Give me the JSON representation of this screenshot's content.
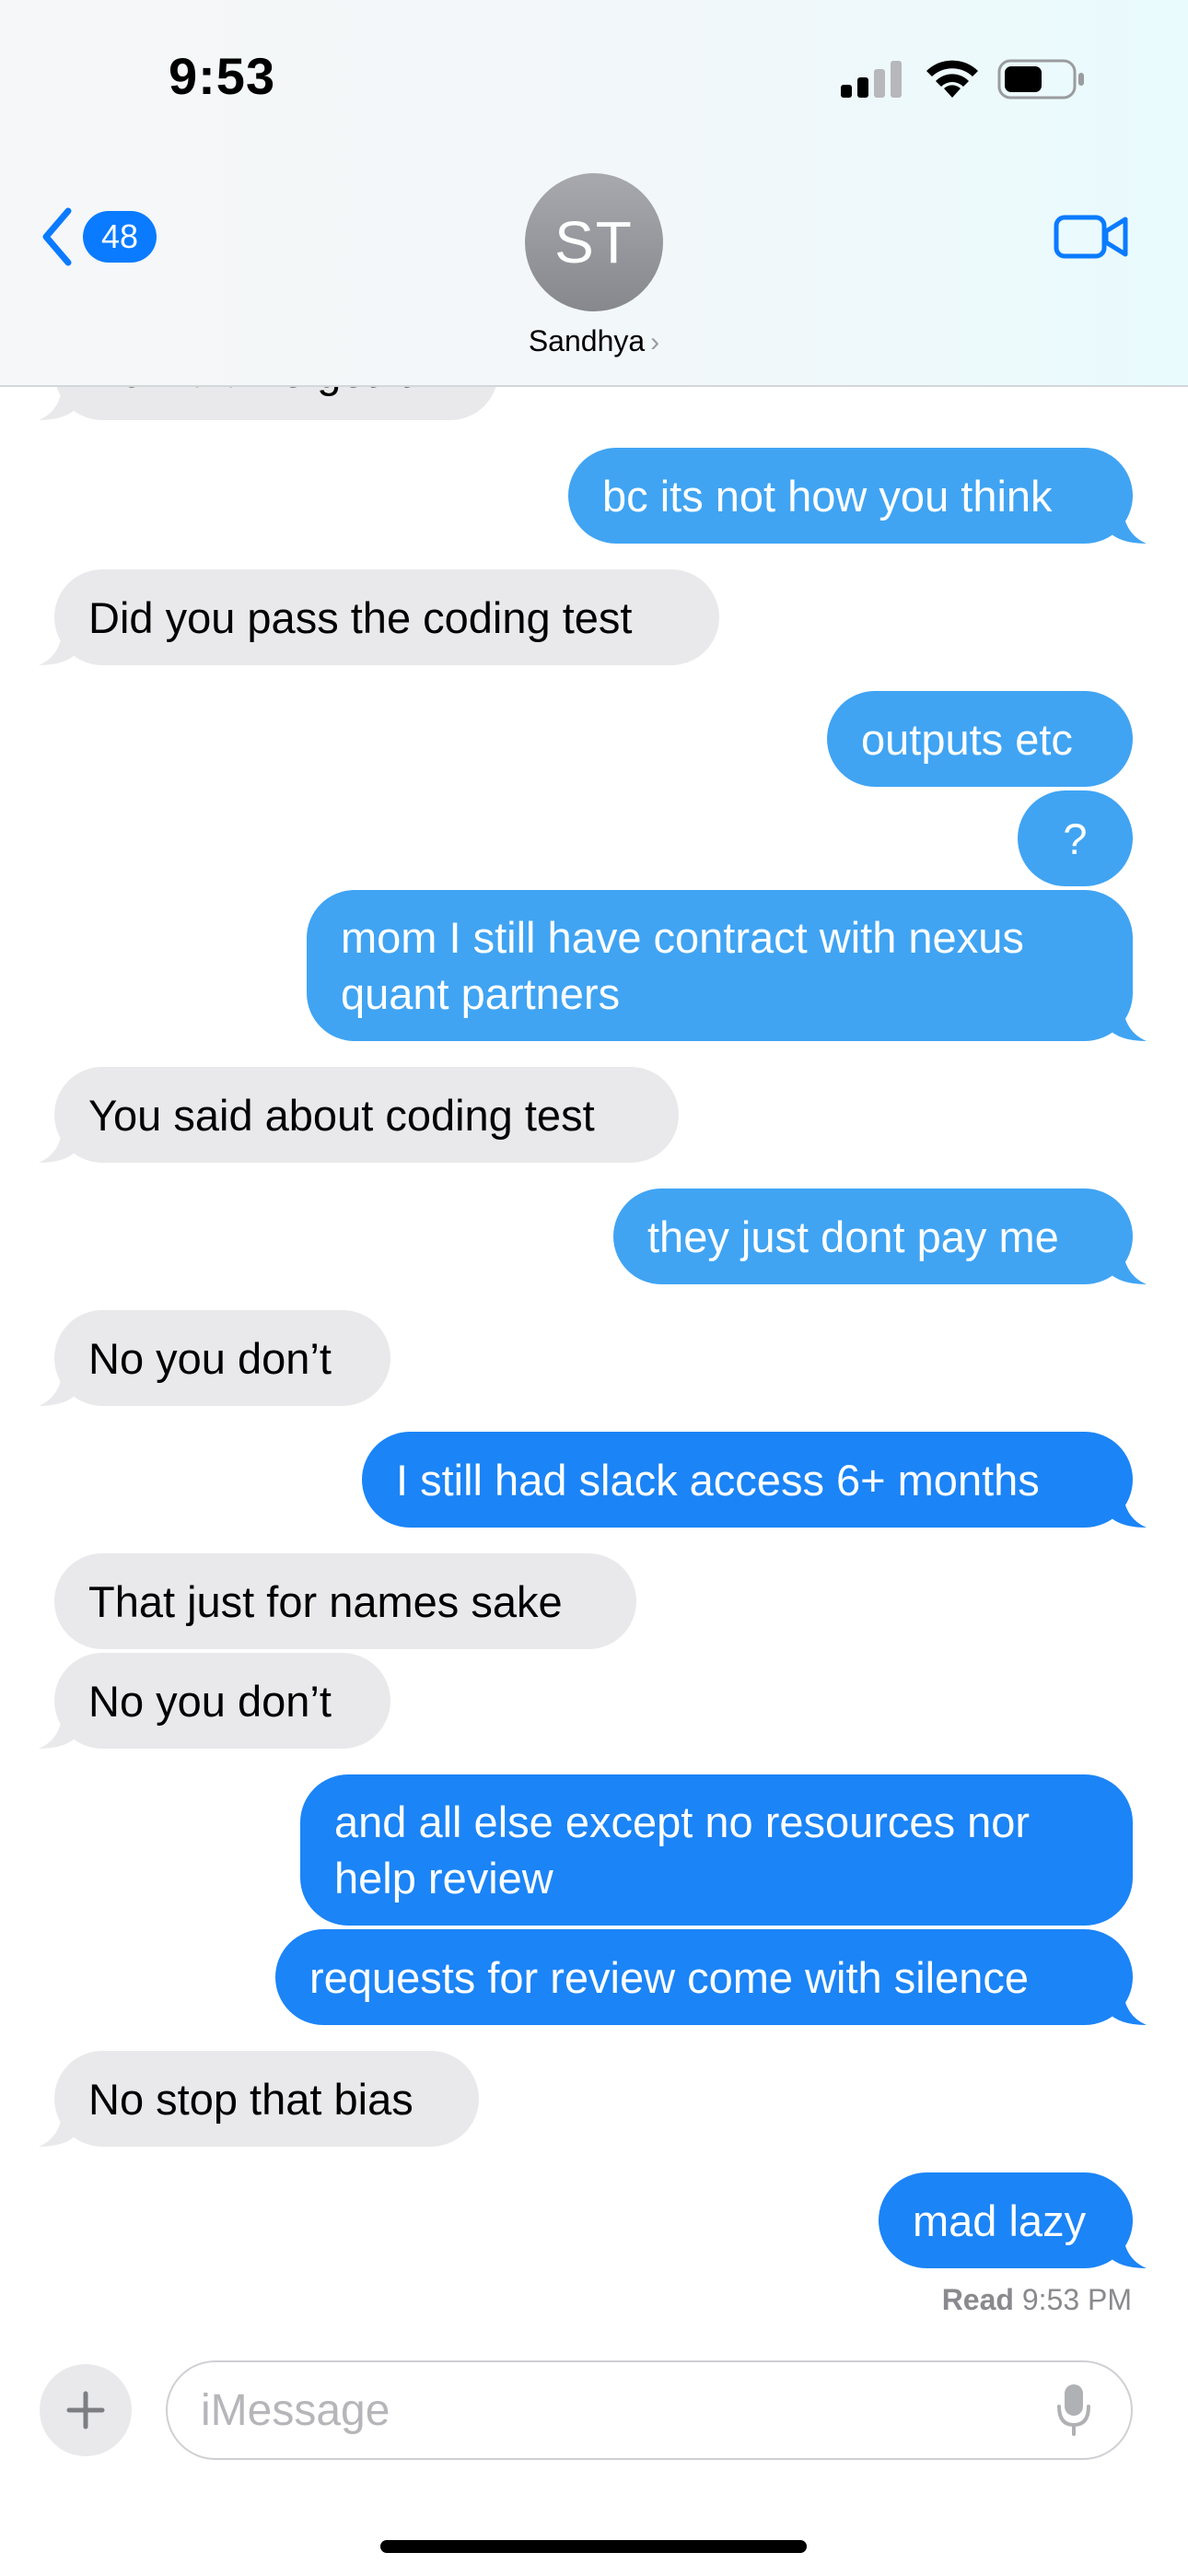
{
  "status_bar": {
    "time": "9:53"
  },
  "header": {
    "back_count": "48",
    "avatar_initials": "ST",
    "contact_name": "Sandhya",
    "contact_chevron": "›",
    "icons": {
      "back": "chevron-left-icon",
      "video": "video-camera-icon"
    },
    "accent_color": "#0a7bff"
  },
  "messages": [
    {
      "side": "received",
      "text": "How did he get it?"
    },
    {
      "side": "sent",
      "text": "bc its not how you think"
    },
    {
      "side": "received",
      "text": "Did you pass the coding test"
    },
    {
      "side": "sent",
      "text": "outputs etc"
    },
    {
      "side": "sent",
      "text": "?"
    },
    {
      "side": "sent",
      "text": "mom I still have contract with nexus quant partners"
    },
    {
      "side": "received",
      "text": "You said about coding test"
    },
    {
      "side": "sent",
      "text": "they just dont pay me"
    },
    {
      "side": "received",
      "text": "No you don’t"
    },
    {
      "side": "sent",
      "text": "I still had slack access 6+ months"
    },
    {
      "side": "received",
      "text": "That just for names sake"
    },
    {
      "side": "received",
      "text": "No you don’t"
    },
    {
      "side": "sent",
      "text": "and all else except no resources nor help review"
    },
    {
      "side": "sent",
      "text": "requests for review come with silence"
    },
    {
      "side": "received",
      "text": "No stop that bias"
    },
    {
      "side": "sent",
      "text": "mad lazy"
    }
  ],
  "read_receipt": {
    "label": "Read",
    "time": "9:53 PM"
  },
  "composer": {
    "placeholder": "iMessage",
    "icons": {
      "plus": "plus-icon",
      "mic": "microphone-icon"
    }
  },
  "colors": {
    "sent_light": "#40a4f3",
    "sent_dark": "#1b84f7",
    "received": "#e9e9eb"
  }
}
